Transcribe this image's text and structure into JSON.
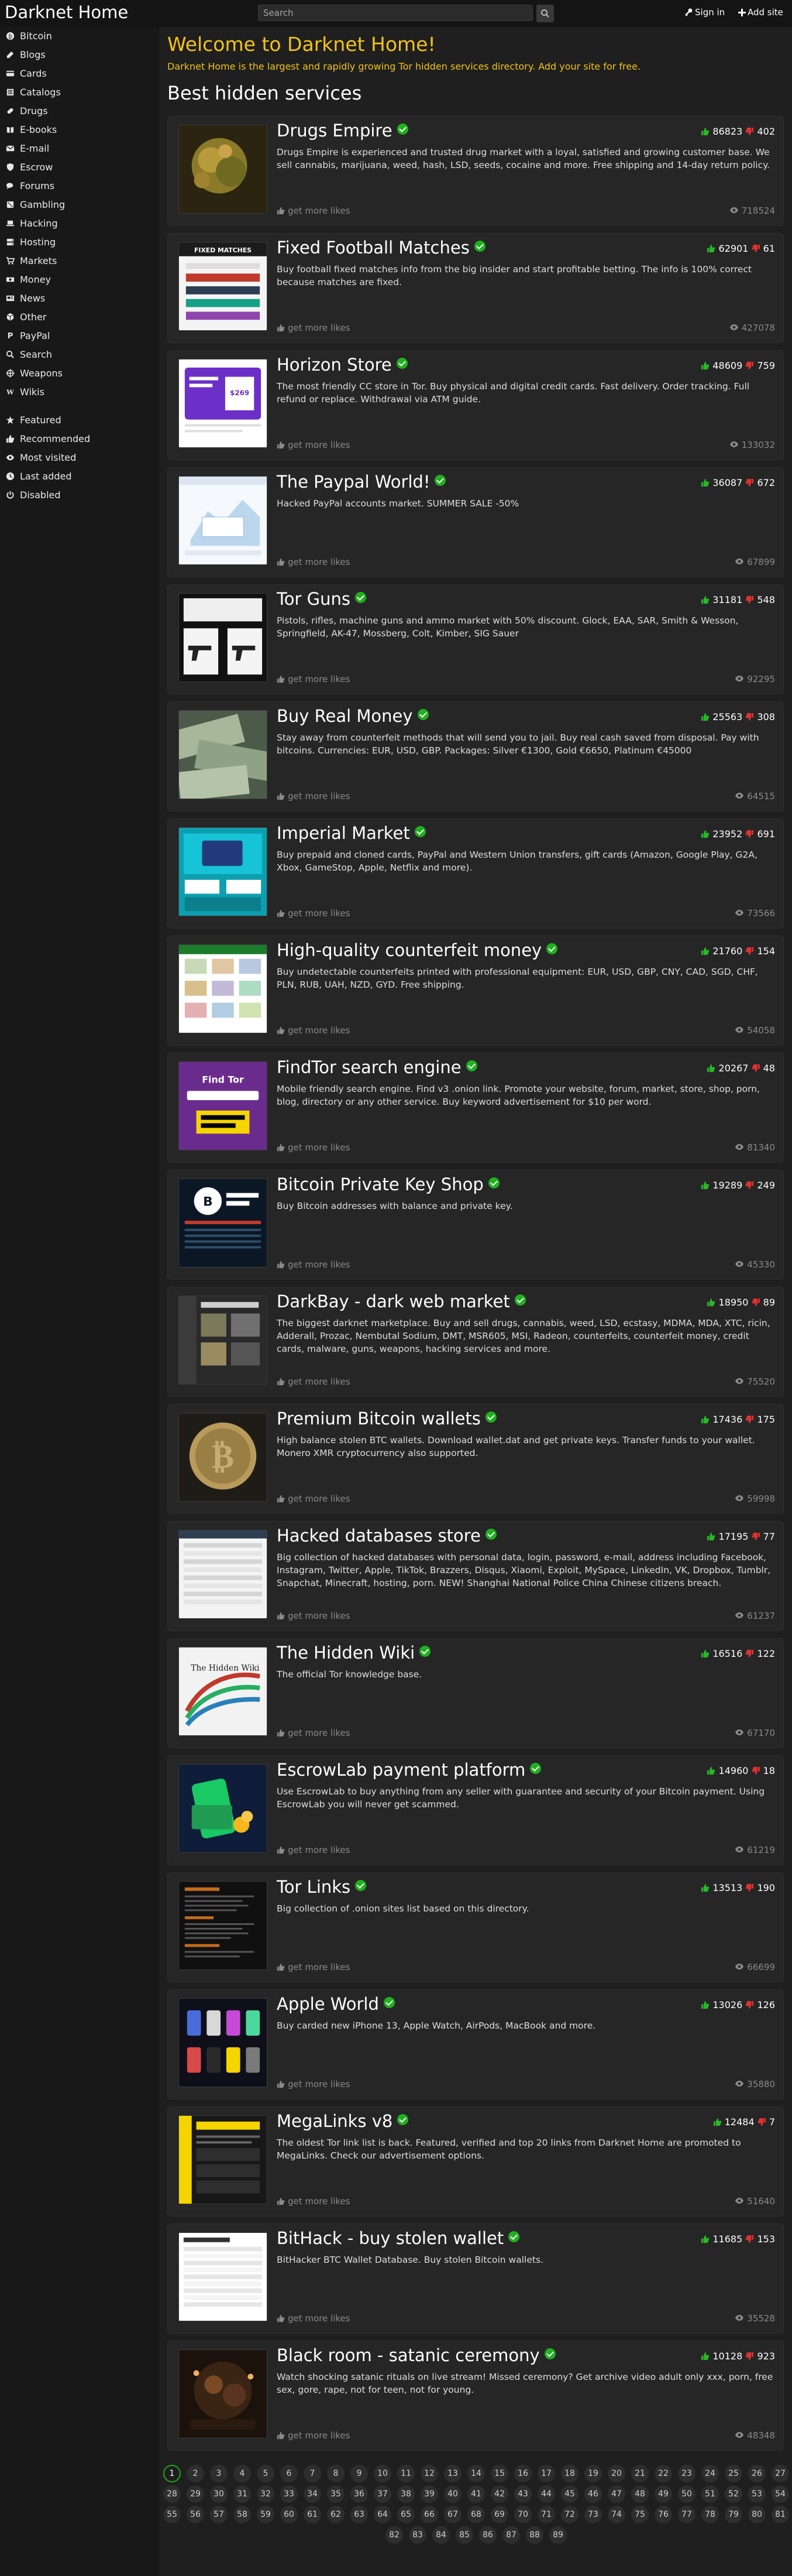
{
  "header": {
    "brand": "Darknet Home",
    "search_placeholder": "Search",
    "sign_in": "Sign in",
    "add_site": "Add site"
  },
  "sidebar": {
    "categories": [
      {
        "label": "Bitcoin",
        "icon": "bitcoin-icon"
      },
      {
        "label": "Blogs",
        "icon": "blog-icon"
      },
      {
        "label": "Cards",
        "icon": "card-icon"
      },
      {
        "label": "Catalogs",
        "icon": "catalog-icon"
      },
      {
        "label": "Drugs",
        "icon": "pills-icon"
      },
      {
        "label": "E-books",
        "icon": "book-icon"
      },
      {
        "label": "E-mail",
        "icon": "envelope-icon"
      },
      {
        "label": "Escrow",
        "icon": "shield-icon"
      },
      {
        "label": "Forums",
        "icon": "comments-icon"
      },
      {
        "label": "Gambling",
        "icon": "dice-icon"
      },
      {
        "label": "Hacking",
        "icon": "laptop-icon"
      },
      {
        "label": "Hosting",
        "icon": "server-icon"
      },
      {
        "label": "Markets",
        "icon": "cart-icon"
      },
      {
        "label": "Money",
        "icon": "money-icon"
      },
      {
        "label": "News",
        "icon": "newspaper-icon"
      },
      {
        "label": "Other",
        "icon": "cube-icon"
      },
      {
        "label": "PayPal",
        "icon": "paypal-icon"
      },
      {
        "label": "Search",
        "icon": "search-icon"
      },
      {
        "label": "Weapons",
        "icon": "crosshairs-icon"
      },
      {
        "label": "Wikis",
        "icon": "wiki-icon"
      }
    ],
    "filters": [
      {
        "label": "Featured",
        "icon": "star-icon"
      },
      {
        "label": "Recommended",
        "icon": "thumbs-up-icon"
      },
      {
        "label": "Most visited",
        "icon": "eye-icon"
      },
      {
        "label": "Last added",
        "icon": "clock-icon"
      },
      {
        "label": "Disabled",
        "icon": "power-icon"
      }
    ]
  },
  "main": {
    "welcome": "Welcome to Darknet Home!",
    "subtitle": "Darknet Home is the largest and rapidly growing Tor hidden services directory. Add your site for free.",
    "section_title": "Best hidden services",
    "more_label": "get more likes",
    "sites": [
      {
        "title": "Drugs Empire",
        "likes": "86823",
        "dislikes": "402",
        "views": "718524",
        "thumb": "drugs-buds",
        "description": "Drugs Empire is experienced and trusted drug market with a loyal, satisfied and growing customer base. We sell cannabis, marijuana, weed, hash, LSD, seeds, cocaine and more. Free shipping and 14-day return policy."
      },
      {
        "title": "Fixed Football Matches",
        "likes": "62901",
        "dislikes": "61",
        "views": "427078",
        "thumb": "football",
        "description": "Buy football fixed matches info from the big insider and start profitable betting. The info is 100% correct because matches are fixed."
      },
      {
        "title": "Horizon Store",
        "likes": "48609",
        "dislikes": "759",
        "views": "133032",
        "thumb": "horizon",
        "description": "The most friendly CC store in Tor. Buy physical and digital credit cards. Fast delivery. Order tracking. Full refund or replace. Withdrawal via ATM guide."
      },
      {
        "title": "The Paypal World!",
        "likes": "36087",
        "dislikes": "672",
        "views": "67899",
        "thumb": "paypal",
        "description": "Hacked PayPal accounts market. SUMMER SALE -50%"
      },
      {
        "title": "Tor Guns",
        "likes": "31181",
        "dislikes": "548",
        "views": "92295",
        "thumb": "guns",
        "description": "Pistols, rifles, machine guns and ammo market with 50% discount. Glock, EAA, SAR, Smith & Wesson, Springfield, AK-47, Mossberg, Colt, Kimber, SIG Sauer"
      },
      {
        "title": "Buy Real Money",
        "likes": "25563",
        "dislikes": "308",
        "views": "64515",
        "thumb": "money",
        "description": "Stay away from counterfeit methods that will send you to jail. Buy real cash saved from disposal. Pay with bitcoins. Currencies: EUR, USD, GBP. Packages: Silver €1300, Gold €6650, Platinum €45000"
      },
      {
        "title": "Imperial Market",
        "likes": "23952",
        "dislikes": "691",
        "views": "73566",
        "thumb": "imperial",
        "description": "Buy prepaid and cloned cards, PayPal and Western Union transfers, gift cards (Amazon, Google Play, G2A, Xbox, GameStop, Apple, Netflix and more)."
      },
      {
        "title": "High-quality counterfeit money",
        "likes": "21760",
        "dislikes": "154",
        "views": "54058",
        "thumb": "counterfeit",
        "description": "Buy undetectable counterfeits printed with professional equipment: EUR, USD, GBP, CNY, CAD, SGD, CHF, PLN, RUB, UAH, NZD, GYD. Free shipping."
      },
      {
        "title": "FindTor search engine",
        "likes": "20267",
        "dislikes": "48",
        "views": "81340",
        "thumb": "findtor",
        "description": "Mobile friendly search engine. Find v3 .onion link. Promote your website, forum, market, store, shop, porn, blog, directory or any other service. Buy keyword advertisement for $10 per word."
      },
      {
        "title": "Bitcoin Private Key Shop",
        "likes": "19289",
        "dislikes": "249",
        "views": "45330",
        "thumb": "keyshop",
        "description": "Buy Bitcoin addresses with balance and private key."
      },
      {
        "title": "DarkBay - dark web market",
        "likes": "18950",
        "dislikes": "89",
        "views": "75520",
        "thumb": "darkbay",
        "description": "The biggest darknet marketplace. Buy and sell drugs, cannabis, weed, LSD, ecstasy, MDMA, MDA, XTC, ricin, Adderall, Prozac, Nembutal Sodium, DMT, MSR605, MSI, Radeon, counterfeits, counterfeit money, credit cards, malware, guns, weapons, hacking services and more."
      },
      {
        "title": "Premium Bitcoin wallets",
        "likes": "17436",
        "dislikes": "175",
        "views": "59998",
        "thumb": "coin",
        "description": "High balance stolen BTC wallets. Download wallet.dat and get private keys. Transfer funds to your wallet. Monero XMR cryptocurrency also supported."
      },
      {
        "title": "Hacked databases store",
        "likes": "17195",
        "dislikes": "77",
        "views": "61237",
        "thumb": "databases",
        "description": "Big collection of hacked databases with personal data, login, password, e-mail, address including Facebook, Instagram, Twitter, Apple, TikTok, Brazzers, Disqus, Xiaomi, Exploit, MySpace, LinkedIn, VK, Dropbox, Tumblr, Snapchat, Minecraft, hosting, porn. NEW! Shanghai National Police China Chinese citizens breach."
      },
      {
        "title": "The Hidden Wiki",
        "likes": "16516",
        "dislikes": "122",
        "views": "67170",
        "thumb": "wiki",
        "description": "The official Tor knowledge base."
      },
      {
        "title": "EscrowLab payment platform",
        "likes": "14960",
        "dislikes": "18",
        "views": "61219",
        "thumb": "escrow",
        "description": "Use EscrowLab to buy anything from any seller with guarantee and security of your Bitcoin payment. Using EscrowLab you will never get scammed."
      },
      {
        "title": "Tor Links",
        "likes": "13513",
        "dislikes": "190",
        "views": "66699",
        "thumb": "torlinks",
        "description": "Big collection of .onion sites list based on this directory."
      },
      {
        "title": "Apple World",
        "likes": "13026",
        "dislikes": "126",
        "views": "35880",
        "thumb": "apple",
        "description": "Buy carded new iPhone 13, Apple Watch, AirPods, MacBook and more."
      },
      {
        "title": "MegaLinks v8",
        "likes": "12484",
        "dislikes": "7",
        "views": "51640",
        "thumb": "megalinks",
        "description": "The oldest Tor link list is back. Featured, verified and top 20 links from Darknet Home are promoted to MegaLinks. Check our advertisement options."
      },
      {
        "title": "BitHack - buy stolen wallet",
        "likes": "11685",
        "dislikes": "153",
        "views": "35528",
        "thumb": "bithack",
        "description": "BitHacker BTC Wallet Database. Buy stolen Bitcoin wallets."
      },
      {
        "title": "Black room - satanic ceremony",
        "likes": "10128",
        "dislikes": "923",
        "views": "48348",
        "thumb": "blackroom",
        "description": "Watch shocking satanic rituals on live stream! Missed ceremony? Get archive video adult only xxx, porn, free sex, gore, rape, not for teen, not for young."
      }
    ]
  },
  "pagination": {
    "current": "1",
    "rows": [
      [
        "1",
        "2",
        "3",
        "4",
        "5",
        "6",
        "7",
        "8",
        "9",
        "10",
        "11",
        "12",
        "13",
        "14",
        "15",
        "16",
        "17",
        "18",
        "19",
        "20",
        "21",
        "22",
        "23",
        "24",
        "25",
        "26",
        "27"
      ],
      [
        "28",
        "29",
        "30",
        "31",
        "32",
        "33",
        "34",
        "35",
        "36",
        "37",
        "38",
        "39",
        "40",
        "41",
        "42",
        "43",
        "44",
        "45",
        "46",
        "47",
        "48",
        "49",
        "50",
        "51",
        "52",
        "53",
        "54"
      ],
      [
        "55",
        "56",
        "57",
        "58",
        "59",
        "60",
        "61",
        "62",
        "63",
        "64",
        "65",
        "66",
        "67",
        "68",
        "69",
        "70",
        "71",
        "72",
        "73",
        "74",
        "75",
        "76",
        "77",
        "78",
        "79",
        "80",
        "81"
      ],
      [
        "82",
        "83",
        "84",
        "85",
        "86",
        "87",
        "88",
        "89"
      ]
    ]
  },
  "colors": {
    "accent_yellow": "#f2c418",
    "verified_green": "#20b020",
    "like_green": "#29b829",
    "dislike_red": "#e03030",
    "background": "#1f1f1f",
    "card": "#262626"
  }
}
